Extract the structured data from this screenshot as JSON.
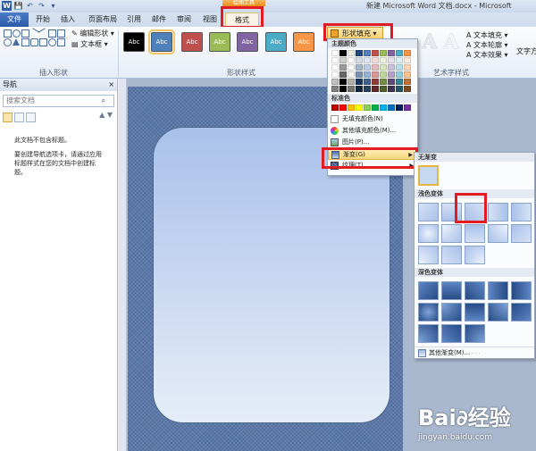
{
  "window": {
    "title": "新建 Microsoft Word 文档.docx - Microsoft",
    "context_tools": "绘图工具",
    "word_logo": "W",
    "qat": [
      "💾",
      "↶",
      "↷",
      "▾"
    ]
  },
  "tabs": [
    {
      "label": "文件",
      "key": "file"
    },
    {
      "label": "开始",
      "key": "home"
    },
    {
      "label": "插入",
      "key": "insert"
    },
    {
      "label": "页面布局",
      "key": "layout"
    },
    {
      "label": "引用",
      "key": "references"
    },
    {
      "label": "邮件",
      "key": "mailings"
    },
    {
      "label": "审阅",
      "key": "review"
    },
    {
      "label": "视图",
      "key": "view"
    },
    {
      "label": "格式",
      "key": "format",
      "active": true
    }
  ],
  "ribbon": {
    "insert_shapes": {
      "label": "插入形状",
      "edit_shape": "编辑形状",
      "text_box": "文本框"
    },
    "shape_styles": {
      "label": "形状样式",
      "swatch_text": "Abc",
      "swatches": [
        "#000000",
        "#4f81bd",
        "#c0504d",
        "#9bbb59",
        "#8064a2",
        "#4bacc6",
        "#f79646"
      ],
      "selected_index": 1
    },
    "shape_fill": "形状填充",
    "wordart_styles": {
      "label": "艺术字样式",
      "text_fill": "文本填充",
      "text_outline": "文本轮廓",
      "text_effects": "文本效果",
      "text_dir": "文字方",
      "letter": "A"
    }
  },
  "nav": {
    "title": "导航",
    "close": "×",
    "search_placeholder": "搜索文档",
    "search_icon": "⌕",
    "arrows": "▲ ▼",
    "message_1": "此文档不包含标题。",
    "message_2": "要创建导航选项卡，请通过应用标题样式在您的文档中创建标题。"
  },
  "fill_menu": {
    "theme_colors_label": "主题颜色",
    "standard_colors_label": "标准色",
    "theme_top": [
      "#ffffff",
      "#000000",
      "#eeece1",
      "#1f497d",
      "#4f81bd",
      "#c0504d",
      "#9bbb59",
      "#8064a2",
      "#4bacc6",
      "#f79646"
    ],
    "standard": [
      "#c00000",
      "#ff0000",
      "#ffc000",
      "#ffff00",
      "#92d050",
      "#00b050",
      "#00b0f0",
      "#0070c0",
      "#002060",
      "#7030a0"
    ],
    "items": [
      {
        "label": "无填充颜色(N)",
        "key": "no-fill"
      },
      {
        "label": "其他填充颜色(M)...",
        "key": "more-colors"
      },
      {
        "label": "图片(P)...",
        "key": "picture"
      },
      {
        "label": "渐变(G)",
        "key": "gradient",
        "hover": true,
        "submenu": true
      },
      {
        "label": "纹理(T)",
        "key": "texture",
        "submenu": true
      }
    ],
    "submenu_arrow": "▶"
  },
  "gradient_menu": {
    "none_label": "无渐变",
    "light_label": "浅色变体",
    "dark_label": "深色变体",
    "more_label": "其他渐变(M)...",
    "grip": "· · · ·"
  },
  "watermark": {
    "logo": "Bai∂经验",
    "url": "jingyan.baidu.com"
  }
}
